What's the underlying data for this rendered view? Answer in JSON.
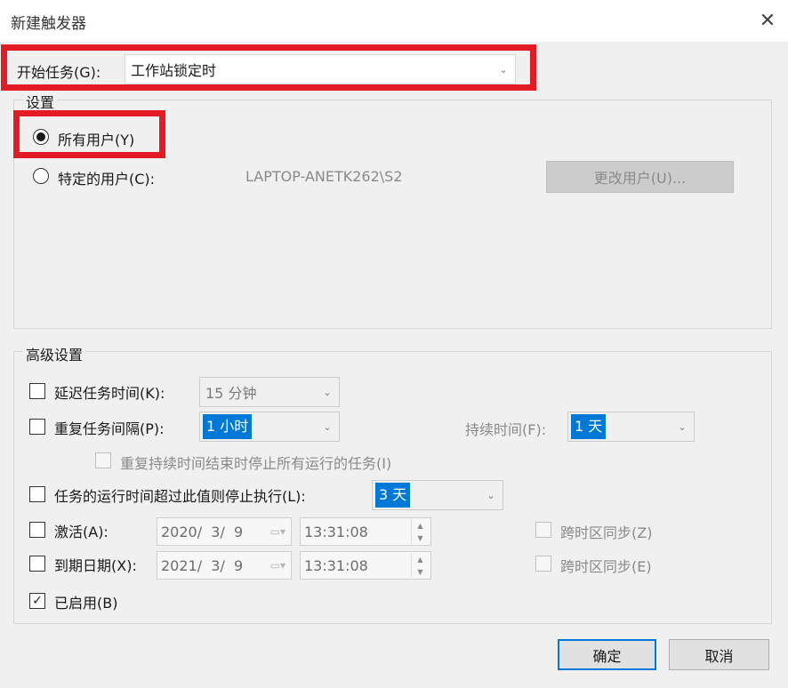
{
  "window": {
    "title": "新建触发器"
  },
  "begin_task": {
    "label": "开始任务(G):",
    "value": "工作站锁定时"
  },
  "settings": {
    "title": "设置",
    "all_users": "所有用户(Y)",
    "specific_user": "特定的用户(C):",
    "user_name": "LAPTOP-ANETK262\\S2",
    "change_user": "更改用户(U)..."
  },
  "advanced": {
    "title": "高级设置",
    "delay": {
      "label": "延迟任务时间(K):",
      "value": "15 分钟"
    },
    "repeat": {
      "label": "重复任务间隔(P):",
      "value": "1 小时"
    },
    "duration": {
      "label": "持续时间(F):",
      "value": "1 天"
    },
    "stop_all": {
      "label": "重复持续时间结束时停止所有运行的任务(I)"
    },
    "stop_if_longer": {
      "label": "任务的运行时间超过此值则停止执行(L):",
      "value": "3 天"
    },
    "activate": {
      "label": "激活(A):",
      "date": "2020/  3/  9",
      "time": "13:31:08",
      "sync": "跨时区同步(Z)"
    },
    "expire": {
      "label": "到期日期(X):",
      "date": "2021/  3/  9",
      "time": "13:31:08",
      "sync": "跨时区同步(E)"
    },
    "enabled": {
      "label": "已启用(B)",
      "check": "✓"
    }
  },
  "buttons": {
    "ok": "确定",
    "cancel": "取消"
  },
  "icons": {
    "close": "✕",
    "chevron": "⌄",
    "calendar": "▭▾",
    "spin_up": "▲",
    "spin_down": "▼"
  },
  "colors": {
    "highlight": "#e21b25",
    "selection": "#0078d7"
  }
}
